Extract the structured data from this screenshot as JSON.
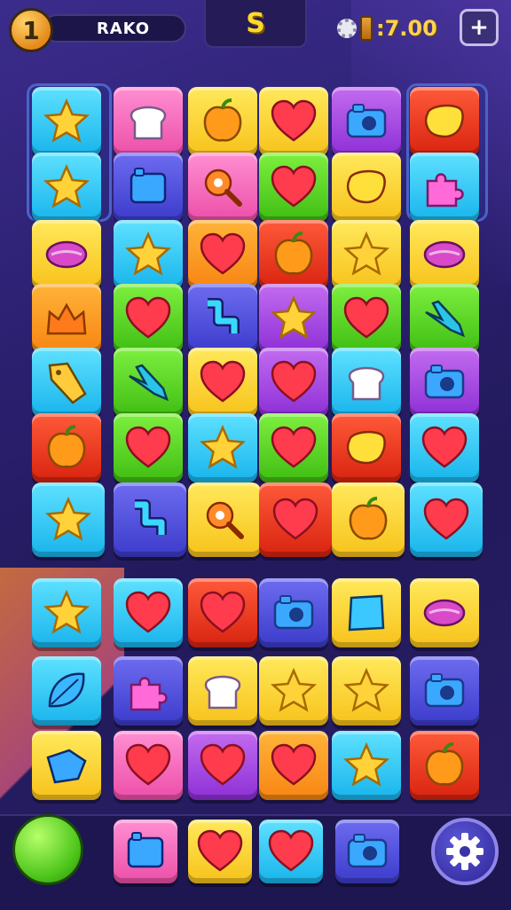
{
  "top_bar": {
    "level": "1",
    "player_name": "RAKO",
    "center_logo": "S",
    "coin_value": ":7.00",
    "plus_symbol": "+"
  },
  "colors": {
    "cyan": "#18b4ec",
    "pink": "#ec4ea8",
    "yellow": "#f7c21a",
    "purple": "#8d2fd6",
    "red": "#d8230f",
    "blue": "#3c3bcb",
    "green": "#3fbd12",
    "orange": "#f78512"
  },
  "board": {
    "rows": [
      [
        {
          "color": "cyan",
          "icon": "star"
        },
        {
          "color": "pink",
          "icon": "bread"
        },
        {
          "color": "yellow",
          "icon": "fruit"
        },
        {
          "color": "yellow",
          "icon": "heart"
        },
        {
          "color": "purple",
          "icon": "camera"
        },
        {
          "color": "red",
          "icon": "blob"
        }
      ],
      [
        {
          "color": "cyan",
          "icon": "star"
        },
        {
          "color": "blue",
          "icon": "box"
        },
        {
          "color": "pink",
          "icon": "key"
        },
        {
          "color": "green",
          "icon": "heart"
        },
        {
          "color": "yellow",
          "icon": "blob"
        },
        {
          "color": "cyan",
          "icon": "puzzle"
        }
      ],
      [
        {
          "color": "yellow",
          "icon": "candy"
        },
        {
          "color": "cyan",
          "icon": "star"
        },
        {
          "color": "orange",
          "icon": "heart"
        },
        {
          "color": "red",
          "icon": "fruit"
        },
        {
          "color": "yellow",
          "icon": "star"
        },
        {
          "color": "yellow",
          "icon": "candy"
        }
      ],
      [
        {
          "color": "orange",
          "icon": "crown"
        },
        {
          "color": "green",
          "icon": "heart"
        },
        {
          "color": "blue",
          "icon": "zigzag"
        },
        {
          "color": "purple",
          "icon": "star"
        },
        {
          "color": "green",
          "icon": "heart"
        },
        {
          "color": "green",
          "icon": "plane"
        }
      ],
      [
        {
          "color": "cyan",
          "icon": "tag"
        },
        {
          "color": "green",
          "icon": "plane"
        },
        {
          "color": "yellow",
          "icon": "heart"
        },
        {
          "color": "purple",
          "icon": "heart"
        },
        {
          "color": "cyan",
          "icon": "bread"
        },
        {
          "color": "purple",
          "icon": "camera"
        }
      ],
      [
        {
          "color": "red",
          "icon": "fruit"
        },
        {
          "color": "green",
          "icon": "heart"
        },
        {
          "color": "cyan",
          "icon": "star"
        },
        {
          "color": "green",
          "icon": "heart"
        },
        {
          "color": "red",
          "icon": "blob"
        },
        {
          "color": "cyan",
          "icon": "heart"
        }
      ],
      [
        {
          "color": "cyan",
          "icon": "star"
        },
        {
          "color": "blue",
          "icon": "zigzag"
        },
        {
          "color": "yellow",
          "icon": "key"
        },
        {
          "color": "red",
          "icon": "heart"
        },
        {
          "color": "yellow",
          "icon": "fruit"
        },
        {
          "color": "cyan",
          "icon": "heart"
        }
      ],
      [
        {
          "color": "cyan",
          "icon": "star"
        },
        {
          "color": "cyan",
          "icon": "heart"
        },
        {
          "color": "red",
          "icon": "heart"
        },
        {
          "color": "blue",
          "icon": "camera"
        },
        {
          "color": "yellow",
          "icon": "diamond"
        },
        {
          "color": "yellow",
          "icon": "candy"
        }
      ],
      [
        {
          "color": "cyan",
          "icon": "leaf"
        },
        {
          "color": "blue",
          "icon": "puzzle"
        },
        {
          "color": "yellow",
          "icon": "bread"
        },
        {
          "color": "yellow",
          "icon": "star"
        },
        {
          "color": "yellow",
          "icon": "star"
        },
        {
          "color": "blue",
          "icon": "camera"
        }
      ],
      [
        {
          "color": "yellow",
          "icon": "flag"
        },
        {
          "color": "pink",
          "icon": "heart"
        },
        {
          "color": "purple",
          "icon": "heart"
        },
        {
          "color": "orange",
          "icon": "heart"
        },
        {
          "color": "cyan",
          "icon": "star"
        },
        {
          "color": "red",
          "icon": "fruit"
        }
      ]
    ]
  },
  "bottom_bar": {
    "items": [
      {
        "color": "pink",
        "icon": "box"
      },
      {
        "color": "yellow",
        "icon": "heart"
      },
      {
        "color": "cyan",
        "icon": "heart"
      },
      {
        "color": "blue",
        "icon": "camera"
      }
    ]
  }
}
